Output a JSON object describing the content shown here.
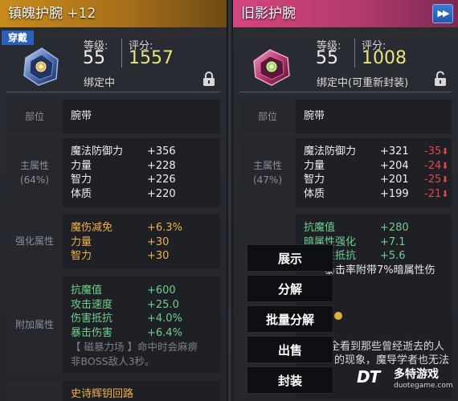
{
  "left": {
    "title": "镇魄护腕",
    "title_plus": "+12",
    "equipped_tag": "穿戴",
    "level_label": "等级:",
    "level": "55",
    "score_label": "评分:",
    "score": "1557",
    "binding": "绑定中",
    "slot_label": "部位",
    "slot_value": "腕带",
    "main_attr_label": "主属性",
    "main_attr_pct": "(64%)",
    "main_attrs": [
      {
        "name": "魔法防御力",
        "value": "+356"
      },
      {
        "name": "力量",
        "value": "+228"
      },
      {
        "name": "智力",
        "value": "+226"
      },
      {
        "name": "体质",
        "value": "+220"
      }
    ],
    "enhance_label": "强化属性",
    "enhance_attrs": [
      {
        "name": "魔伤减免",
        "value": "+6.3%"
      },
      {
        "name": "力量",
        "value": "+30"
      },
      {
        "name": "智力",
        "value": "+30"
      }
    ],
    "extra_label": "附加属性",
    "extra_attrs": [
      {
        "name": "抗魔值",
        "value": "+600"
      },
      {
        "name": "攻击速度",
        "value": "+25.0"
      },
      {
        "name": "伤害抵抗",
        "value": "+4.0%"
      },
      {
        "name": "暴击伤害",
        "value": "+6.4%"
      }
    ],
    "extra_note_1": "【 磁暴力场 】命中时会麻痹",
    "extra_note_2": "非BOSS敌人3秒。",
    "set_name": "史诗辉钥回路"
  },
  "right": {
    "title": "旧影护腕",
    "level_label": "等级:",
    "level": "55",
    "score_label": "评分:",
    "score": "1008",
    "binding": "绑定中(可重新封装)",
    "slot_label": "部位",
    "slot_value": "腕带",
    "main_attr_label": "主属性",
    "main_attr_pct": "(47%)",
    "main_attrs": [
      {
        "name": "魔法防御力",
        "value": "+321",
        "diff": "-35"
      },
      {
        "name": "力量",
        "value": "+204",
        "diff": "-24"
      },
      {
        "name": "智力",
        "value": "+201",
        "diff": "-25"
      },
      {
        "name": "体质",
        "value": "+199",
        "diff": "-21"
      }
    ],
    "extra_attrs": [
      {
        "name": "抗魔值",
        "value": "+280"
      },
      {
        "name": "暗属性强化",
        "value": "+7.1"
      },
      {
        "name": "性抵抗",
        "value": "+5.6"
      }
    ],
    "extra_partial": "暴击率附带7%暗属性伤",
    "desc_1": "全看到那些曾经逝去的人",
    "desc_2": "的现象，魔导学者也无法"
  },
  "menu": {
    "items": [
      "展示",
      "分解",
      "批量分解",
      "出售",
      "封装"
    ]
  },
  "watermark": {
    "logo": "DT",
    "cn": "多特游戏",
    "en": "duotegame.com"
  },
  "icons": {
    "fast_forward": "fast-forward-icon",
    "lock": "lock-icon",
    "item_left": "bracer-icon",
    "item_right": "bracer-icon"
  },
  "colors": {
    "score": "#e8e67a",
    "enhance": "#f0b14a",
    "extra": "#6fd08c",
    "decrease": "#e04848",
    "left_title": "#c98a1c",
    "right_title": "#d6457e"
  }
}
